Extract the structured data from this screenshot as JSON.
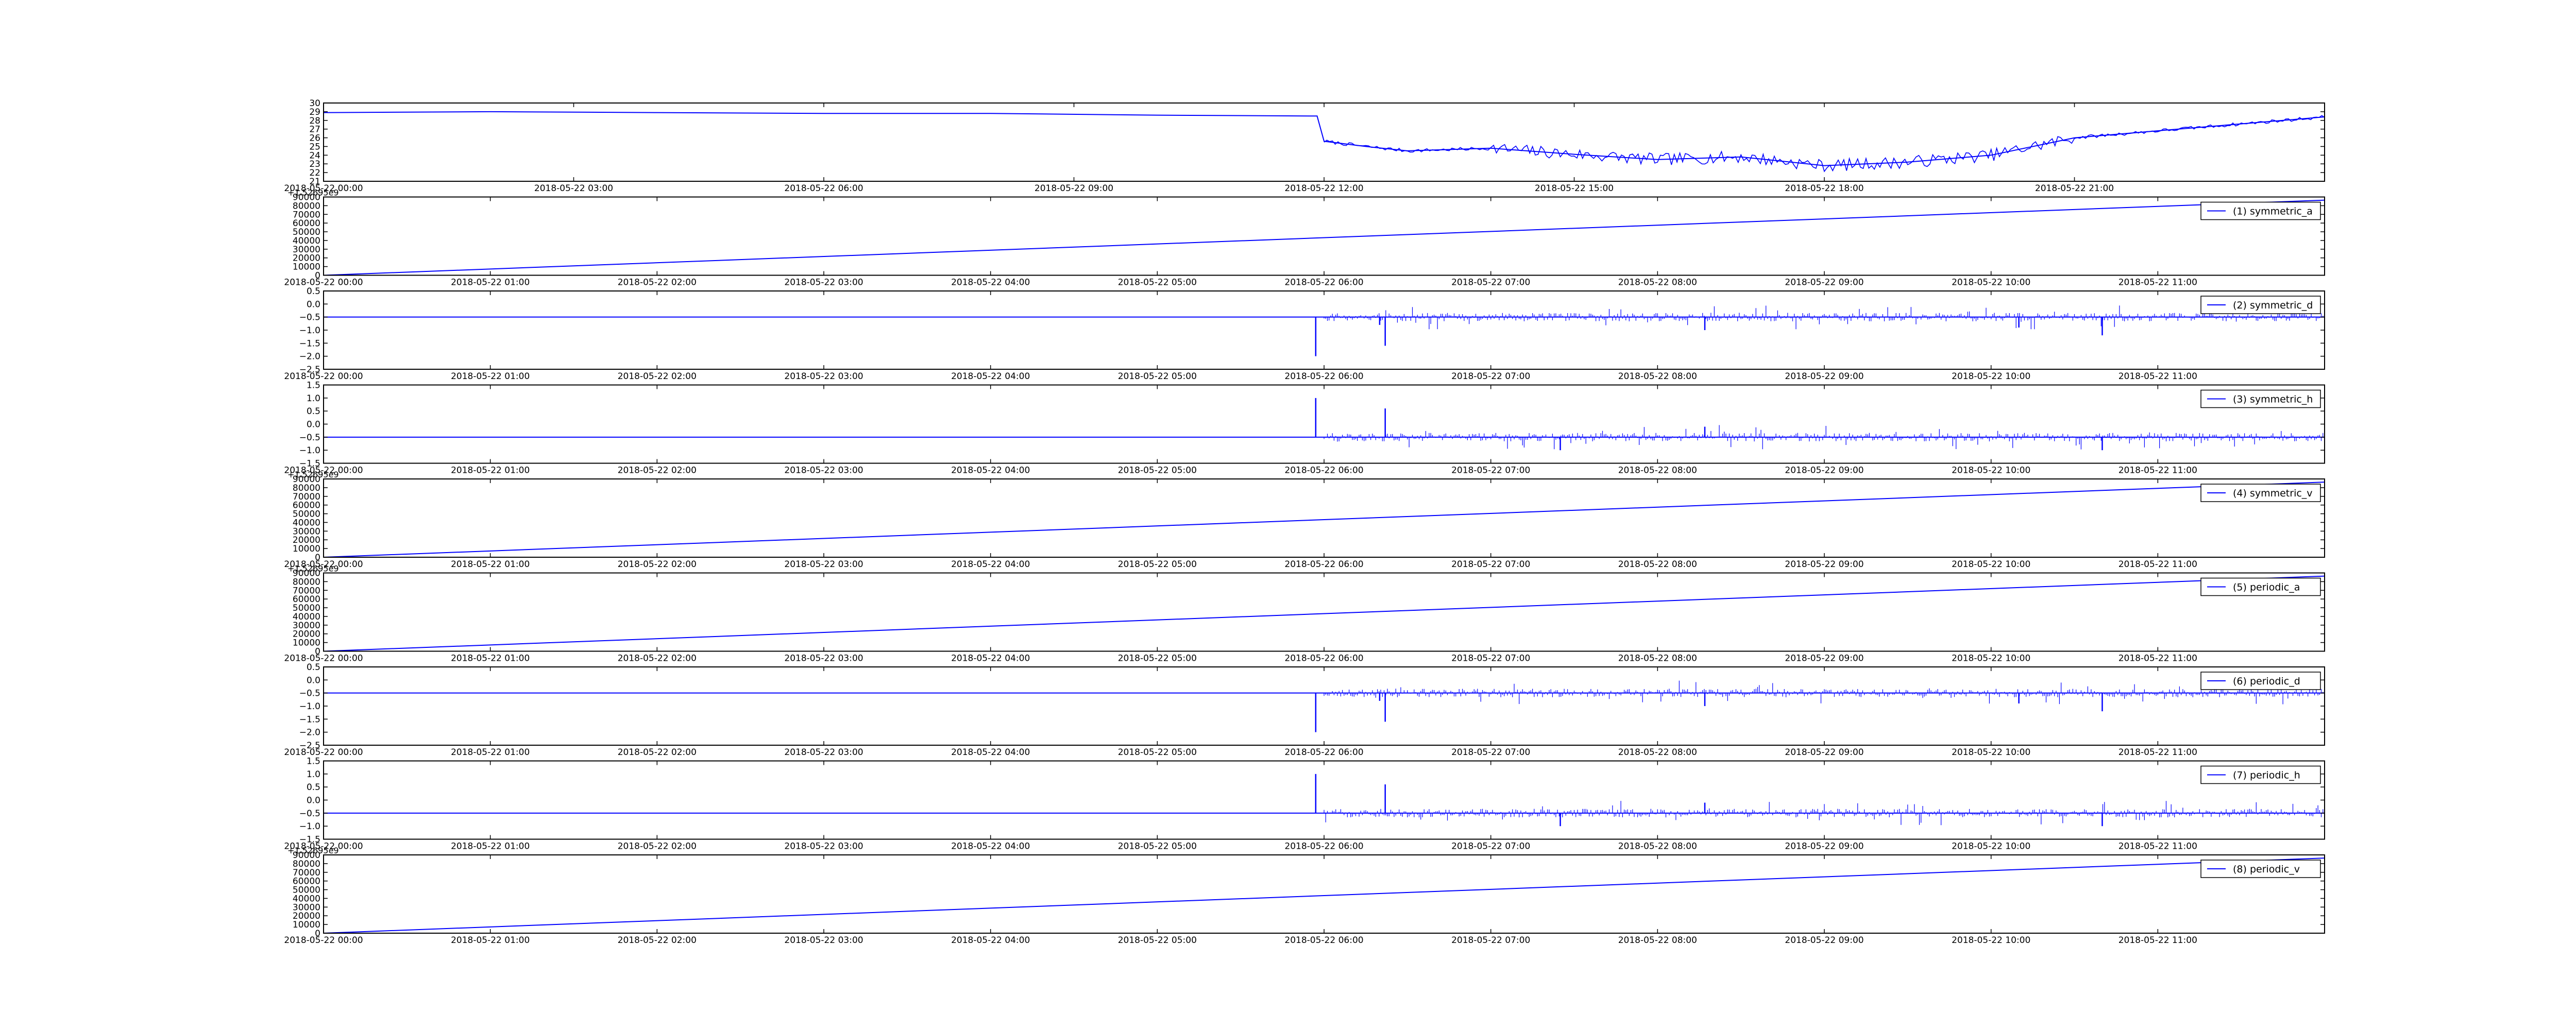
{
  "figure": {
    "background": "#ffffff",
    "line_color": "#0000ff",
    "axis_color": "#000000"
  },
  "chart_data": [
    {
      "type": "line",
      "id": "temperature",
      "x_start": "2018-05-22 00:00",
      "x_end": "2018-05-23 00:00",
      "xticks": [
        "2018-05-22 00:00",
        "2018-05-22 03:00",
        "2018-05-22 06:00",
        "2018-05-22 09:00",
        "2018-05-22 12:00",
        "2018-05-22 15:00",
        "2018-05-22 18:00",
        "2018-05-22 21:00"
      ],
      "ylim": [
        21,
        30
      ],
      "yticks": [
        "21",
        "22",
        "23",
        "24",
        "25",
        "26",
        "27",
        "28",
        "29",
        "30"
      ],
      "legend": "",
      "series": [
        {
          "x": [
            "2018-05-22 00:00",
            "2018-05-22 02:00",
            "2018-05-22 04:00",
            "2018-05-22 06:00",
            "2018-05-22 08:00",
            "2018-05-22 10:00",
            "2018-05-22 11:55",
            "2018-05-22 12:00",
            "2018-05-22 12:30",
            "2018-05-22 13:00",
            "2018-05-22 14:00",
            "2018-05-22 15:00",
            "2018-05-22 16:00",
            "2018-05-22 17:00",
            "2018-05-22 18:00",
            "2018-05-22 19:00",
            "2018-05-22 20:00",
            "2018-05-22 21:00",
            "2018-05-22 22:00",
            "2018-05-22 23:00",
            "2018-05-23 00:00"
          ],
          "y": [
            28.9,
            29.0,
            28.9,
            28.8,
            28.8,
            28.6,
            28.5,
            25.6,
            25.0,
            24.5,
            24.8,
            24.1,
            23.5,
            23.8,
            22.8,
            23.2,
            24.0,
            26.0,
            26.8,
            27.6,
            28.4
          ]
        }
      ]
    },
    {
      "type": "line",
      "id": "symmetric_a",
      "x_start": "2018-05-22 00:00",
      "x_end": "2018-05-22 12:00",
      "xticks": [
        "2018-05-22 00:00",
        "2018-05-22 01:00",
        "2018-05-22 02:00",
        "2018-05-22 03:00",
        "2018-05-22 04:00",
        "2018-05-22 05:00",
        "2018-05-22 06:00",
        "2018-05-22 07:00",
        "2018-05-22 08:00",
        "2018-05-22 09:00",
        "2018-05-22 10:00",
        "2018-05-22 11:00"
      ],
      "ylim": [
        0,
        90000
      ],
      "yticks": [
        "0",
        "10000",
        "20000",
        "30000",
        "40000",
        "50000",
        "60000",
        "70000",
        "80000",
        "90000"
      ],
      "offset_text": "+1.52695e9",
      "legend": "(1) symmetric_a",
      "series": [
        {
          "x": [
            "2018-05-22 00:00",
            "2018-05-22 12:00"
          ],
          "y": [
            0,
            86400
          ]
        }
      ]
    },
    {
      "type": "line",
      "id": "symmetric_d",
      "x_start": "2018-05-22 00:00",
      "x_end": "2018-05-22 12:00",
      "xticks": [
        "2018-05-22 00:00",
        "2018-05-22 01:00",
        "2018-05-22 02:00",
        "2018-05-22 03:00",
        "2018-05-22 04:00",
        "2018-05-22 05:00",
        "2018-05-22 06:00",
        "2018-05-22 07:00",
        "2018-05-22 08:00",
        "2018-05-22 09:00",
        "2018-05-22 10:00",
        "2018-05-22 11:00"
      ],
      "ylim": [
        -2.5,
        0.5
      ],
      "yticks": [
        "−2.5",
        "−2.0",
        "−1.5",
        "−1.0",
        "−0.5",
        "0.0",
        "0.5"
      ],
      "legend": "(2) symmetric_d",
      "baseline": -0.5,
      "noise_start": "2018-05-22 06:00",
      "spikes": [
        {
          "x": "2018-05-22 05:57",
          "y": -2.0
        },
        {
          "x": "2018-05-22 06:20",
          "y": -0.8
        },
        {
          "x": "2018-05-22 06:22",
          "y": -1.6
        },
        {
          "x": "2018-05-22 08:17",
          "y": -1.0
        },
        {
          "x": "2018-05-22 10:10",
          "y": -0.9
        },
        {
          "x": "2018-05-22 10:40",
          "y": -1.2
        }
      ]
    },
    {
      "type": "line",
      "id": "symmetric_h",
      "x_start": "2018-05-22 00:00",
      "x_end": "2018-05-22 12:00",
      "xticks": [
        "2018-05-22 00:00",
        "2018-05-22 01:00",
        "2018-05-22 02:00",
        "2018-05-22 03:00",
        "2018-05-22 04:00",
        "2018-05-22 05:00",
        "2018-05-22 06:00",
        "2018-05-22 07:00",
        "2018-05-22 08:00",
        "2018-05-22 09:00",
        "2018-05-22 10:00",
        "2018-05-22 11:00"
      ],
      "ylim": [
        -1.5,
        1.5
      ],
      "yticks": [
        "−1.5",
        "−1.0",
        "−0.5",
        "0.0",
        "0.5",
        "1.0",
        "1.5"
      ],
      "legend": "(3) symmetric_h",
      "baseline": -0.5,
      "noise_start": "2018-05-22 06:00",
      "spikes": [
        {
          "x": "2018-05-22 05:57",
          "y": 1.0
        },
        {
          "x": "2018-05-22 06:22",
          "y": 0.6
        },
        {
          "x": "2018-05-22 07:25",
          "y": -1.0
        },
        {
          "x": "2018-05-22 08:17",
          "y": -0.1
        },
        {
          "x": "2018-05-22 10:40",
          "y": -1.0
        }
      ]
    },
    {
      "type": "line",
      "id": "symmetric_v",
      "x_start": "2018-05-22 00:00",
      "x_end": "2018-05-22 12:00",
      "xticks": [
        "2018-05-22 00:00",
        "2018-05-22 01:00",
        "2018-05-22 02:00",
        "2018-05-22 03:00",
        "2018-05-22 04:00",
        "2018-05-22 05:00",
        "2018-05-22 06:00",
        "2018-05-22 07:00",
        "2018-05-22 08:00",
        "2018-05-22 09:00",
        "2018-05-22 10:00",
        "2018-05-22 11:00"
      ],
      "ylim": [
        0,
        90000
      ],
      "yticks": [
        "0",
        "10000",
        "20000",
        "30000",
        "40000",
        "50000",
        "60000",
        "70000",
        "80000",
        "90000"
      ],
      "offset_text": "+1.52695e9",
      "legend": "(4) symmetric_v",
      "series": [
        {
          "x": [
            "2018-05-22 00:00",
            "2018-05-22 12:00"
          ],
          "y": [
            0,
            86400
          ]
        }
      ]
    },
    {
      "type": "line",
      "id": "periodic_a",
      "x_start": "2018-05-22 00:00",
      "x_end": "2018-05-22 12:00",
      "xticks": [
        "2018-05-22 00:00",
        "2018-05-22 01:00",
        "2018-05-22 02:00",
        "2018-05-22 03:00",
        "2018-05-22 04:00",
        "2018-05-22 05:00",
        "2018-05-22 06:00",
        "2018-05-22 07:00",
        "2018-05-22 08:00",
        "2018-05-22 09:00",
        "2018-05-22 10:00",
        "2018-05-22 11:00"
      ],
      "ylim": [
        0,
        90000
      ],
      "yticks": [
        "0",
        "10000",
        "20000",
        "30000",
        "40000",
        "50000",
        "60000",
        "70000",
        "80000",
        "90000"
      ],
      "offset_text": "+1.52695e9",
      "legend": "(5) periodic_a",
      "series": [
        {
          "x": [
            "2018-05-22 00:00",
            "2018-05-22 12:00"
          ],
          "y": [
            0,
            86400
          ]
        }
      ]
    },
    {
      "type": "line",
      "id": "periodic_d",
      "x_start": "2018-05-22 00:00",
      "x_end": "2018-05-22 12:00",
      "xticks": [
        "2018-05-22 00:00",
        "2018-05-22 01:00",
        "2018-05-22 02:00",
        "2018-05-22 03:00",
        "2018-05-22 04:00",
        "2018-05-22 05:00",
        "2018-05-22 06:00",
        "2018-05-22 07:00",
        "2018-05-22 08:00",
        "2018-05-22 09:00",
        "2018-05-22 10:00",
        "2018-05-22 11:00"
      ],
      "ylim": [
        -2.5,
        0.5
      ],
      "yticks": [
        "−2.5",
        "−2.0",
        "−1.5",
        "−1.0",
        "−0.5",
        "0.0",
        "0.5"
      ],
      "legend": "(6) periodic_d",
      "baseline": -0.5,
      "noise_start": "2018-05-22 06:00",
      "spikes": [
        {
          "x": "2018-05-22 05:57",
          "y": -2.0
        },
        {
          "x": "2018-05-22 06:20",
          "y": -0.8
        },
        {
          "x": "2018-05-22 06:22",
          "y": -1.6
        },
        {
          "x": "2018-05-22 08:17",
          "y": -1.0
        },
        {
          "x": "2018-05-22 10:10",
          "y": -0.9
        },
        {
          "x": "2018-05-22 10:40",
          "y": -1.2
        }
      ]
    },
    {
      "type": "line",
      "id": "periodic_h",
      "x_start": "2018-05-22 00:00",
      "x_end": "2018-05-22 12:00",
      "xticks": [
        "2018-05-22 00:00",
        "2018-05-22 01:00",
        "2018-05-22 02:00",
        "2018-05-22 03:00",
        "2018-05-22 04:00",
        "2018-05-22 05:00",
        "2018-05-22 06:00",
        "2018-05-22 07:00",
        "2018-05-22 08:00",
        "2018-05-22 09:00",
        "2018-05-22 10:00",
        "2018-05-22 11:00"
      ],
      "ylim": [
        -1.5,
        1.5
      ],
      "yticks": [
        "−1.5",
        "−1.0",
        "−0.5",
        "0.0",
        "0.5",
        "1.0",
        "1.5"
      ],
      "legend": "(7) periodic_h",
      "baseline": -0.5,
      "noise_start": "2018-05-22 06:00",
      "spikes": [
        {
          "x": "2018-05-22 05:57",
          "y": 1.0
        },
        {
          "x": "2018-05-22 06:22",
          "y": 0.6
        },
        {
          "x": "2018-05-22 07:25",
          "y": -1.0
        },
        {
          "x": "2018-05-22 08:17",
          "y": -0.1
        },
        {
          "x": "2018-05-22 10:40",
          "y": -1.0
        }
      ]
    },
    {
      "type": "line",
      "id": "periodic_v",
      "x_start": "2018-05-22 00:00",
      "x_end": "2018-05-22 12:00",
      "xticks": [
        "2018-05-22 00:00",
        "2018-05-22 01:00",
        "2018-05-22 02:00",
        "2018-05-22 03:00",
        "2018-05-22 04:00",
        "2018-05-22 05:00",
        "2018-05-22 06:00",
        "2018-05-22 07:00",
        "2018-05-22 08:00",
        "2018-05-22 09:00",
        "2018-05-22 10:00",
        "2018-05-22 11:00"
      ],
      "ylim": [
        0,
        90000
      ],
      "yticks": [
        "0",
        "10000",
        "20000",
        "30000",
        "40000",
        "50000",
        "60000",
        "70000",
        "80000",
        "90000"
      ],
      "offset_text": "+1.52695e9",
      "legend": "(8) periodic_v",
      "series": [
        {
          "x": [
            "2018-05-22 00:00",
            "2018-05-22 12:00"
          ],
          "y": [
            0,
            86400
          ]
        }
      ]
    }
  ]
}
